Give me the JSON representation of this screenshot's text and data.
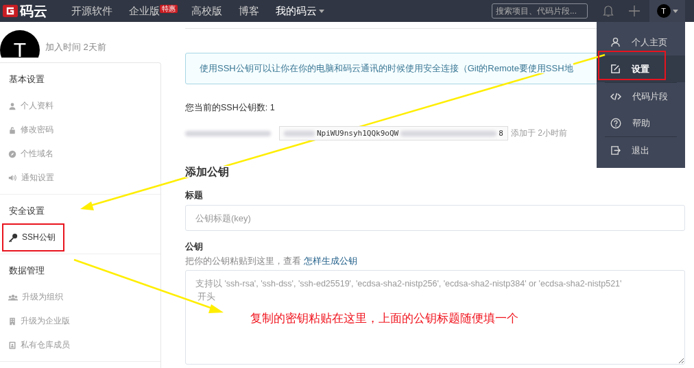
{
  "navbar": {
    "logo": "码云",
    "nav_items": [
      {
        "label": "开源软件",
        "dropdown": false
      },
      {
        "label": "企业版",
        "badge": "特惠",
        "dropdown": false
      },
      {
        "label": "高校版",
        "dropdown": false
      },
      {
        "label": "博客",
        "dropdown": false
      },
      {
        "label": "我的码云",
        "dropdown": true
      }
    ],
    "search": {
      "placeholder": "搜索项目、代码片段..."
    },
    "avatar_letter": "T"
  },
  "user_menu": {
    "groups": [
      {
        "items": [
          {
            "label": "个人主页",
            "selected": false
          },
          {
            "label": "设置",
            "selected": true
          }
        ]
      },
      {
        "items": [
          {
            "label": "代码片段",
            "selected": false
          },
          {
            "label": "帮助",
            "selected": false
          }
        ]
      },
      {
        "items": [
          {
            "label": "退出",
            "selected": false
          }
        ]
      }
    ]
  },
  "profile": {
    "avatar_letter": "T",
    "joined": "加入时间 2天前"
  },
  "sidebar": {
    "sections": [
      {
        "title": "基本设置",
        "items": [
          {
            "label": "个人资料",
            "selected": false
          },
          {
            "label": "修改密码",
            "selected": false
          },
          {
            "label": "个性域名",
            "selected": false
          },
          {
            "label": "通知设置",
            "selected": false
          }
        ]
      },
      {
        "title": "安全设置",
        "items": [
          {
            "label": "SSH公钥",
            "selected": true
          }
        ]
      },
      {
        "title": "数据管理",
        "items": [
          {
            "label": "升级为组织",
            "selected": false
          },
          {
            "label": "升级为企业版",
            "selected": false
          },
          {
            "label": "私有仓库成员",
            "selected": false
          }
        ]
      }
    ]
  },
  "main": {
    "notice": "使用SSH公钥可以让你在你的电脑和码云通讯的时候使用安全连接（Git的Remote要使用SSH地",
    "key_count": "您当前的SSH公钥数: 1",
    "keys": [
      {
        "fingerprint_visible": "NpiWU9nsyh1QQk9oQW",
        "fingerprint_end": "8",
        "added": "添加于 2小时前"
      }
    ],
    "add_title": "添加公钥",
    "form": {
      "title_label": "标题",
      "title_placeholder": "公钥标题(key)",
      "key_label": "公钥",
      "key_help": "把你的公钥粘贴到这里，查看 ",
      "key_help_link": "怎样生成公钥",
      "key_placeholder": "支持以 'ssh-rsa', 'ssh-dss', 'ssh-ed25519', 'ecdsa-sha2-nistp256', 'ecdsa-sha2-nistp384' or 'ecdsa-sha2-nistp521'\n 开头"
    }
  },
  "annotation": {
    "note": "复制的密钥粘贴在这里，上面的公钥标题随便填一个"
  }
}
